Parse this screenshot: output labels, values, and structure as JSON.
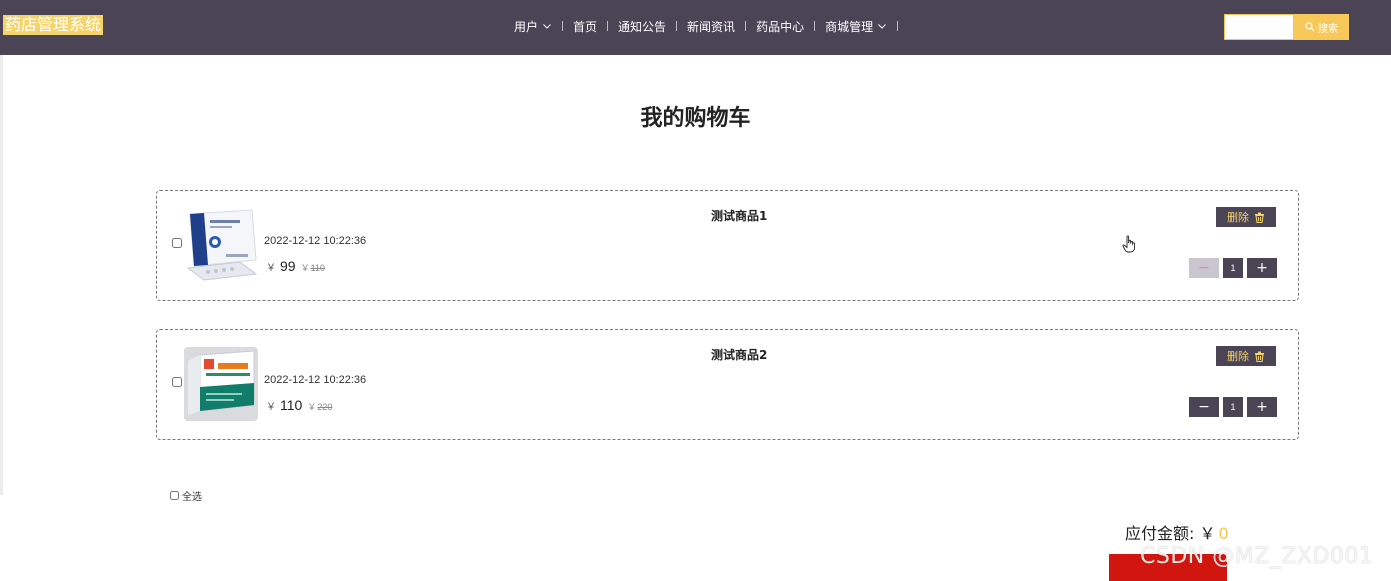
{
  "app": {
    "logo_text": "药店管理系统"
  },
  "nav": {
    "items": [
      {
        "label": "用户",
        "dropdown": true
      },
      {
        "label": "首页",
        "dropdown": false
      },
      {
        "label": "通知公告",
        "dropdown": false
      },
      {
        "label": "新闻资讯",
        "dropdown": false
      },
      {
        "label": "药品中心",
        "dropdown": false
      },
      {
        "label": "商城管理",
        "dropdown": true
      }
    ]
  },
  "search": {
    "value": "",
    "button_label": "搜索",
    "icon": "search-icon"
  },
  "page": {
    "title": "我的购物车"
  },
  "cart": {
    "items": [
      {
        "name": "测试商品1",
        "date": "2022-12-12 10:22:36",
        "currency": "￥",
        "price": "99",
        "old_price": "110",
        "quantity": "1",
        "delete_label": "删除",
        "minus_disabled": true
      },
      {
        "name": "测试商品2",
        "date": "2022-12-12 10:22:36",
        "currency": "￥",
        "price": "110",
        "old_price": "220",
        "quantity": "1",
        "delete_label": "删除",
        "minus_disabled": false
      }
    ],
    "select_all_label": "全选",
    "total_label": "应付金额: ￥",
    "total_amount": "0"
  },
  "watermark": "CSDN @MZ_ZXD001",
  "colors": {
    "nav_bg": "#4a4455",
    "accent_yellow": "#f5d46b",
    "pay_red": "#d0160f"
  }
}
